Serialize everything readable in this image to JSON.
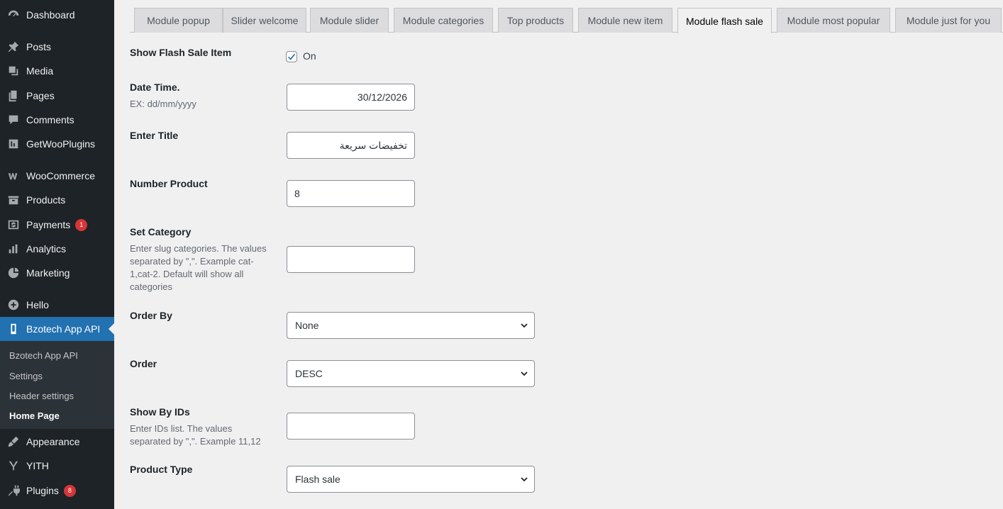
{
  "sidebar": {
    "items": [
      {
        "label": "Dashboard",
        "icon": "dashboard-icon"
      },
      {
        "label": "Posts",
        "icon": "pin-icon"
      },
      {
        "label": "Media",
        "icon": "media-icon"
      },
      {
        "label": "Pages",
        "icon": "pages-icon"
      },
      {
        "label": "Comments",
        "icon": "comment-icon"
      },
      {
        "label": "GetWooPlugins",
        "icon": "plugin-gear-icon"
      },
      {
        "label": "WooCommerce",
        "icon": "woo-icon"
      },
      {
        "label": "Products",
        "icon": "archive-icon"
      },
      {
        "label": "Payments",
        "icon": "dollar-icon",
        "badge": "1"
      },
      {
        "label": "Analytics",
        "icon": "bar-chart-icon"
      },
      {
        "label": "Marketing",
        "icon": "megaphone-icon"
      },
      {
        "label": "Hello",
        "icon": "plus-circle-icon"
      },
      {
        "label": "Bzotech App API",
        "icon": "phone-icon"
      },
      {
        "label": "Appearance",
        "icon": "brush-icon"
      },
      {
        "label": "YITH",
        "icon": "yith-icon"
      },
      {
        "label": "Plugins",
        "icon": "plug-icon",
        "badge": "8"
      }
    ],
    "submenu": [
      "Bzotech App API",
      "Settings",
      "Header settings",
      "Home Page"
    ],
    "accent": "#2271b1"
  },
  "tabs": [
    "Module popup",
    "Slider welcome",
    "Module slider",
    "Module categories",
    "Top products",
    "Module new item",
    "Module flash sale",
    "Module most popular",
    "Module just for you"
  ],
  "form": {
    "show_flash": {
      "label": "Show Flash Sale Item",
      "checked": true,
      "option": "On"
    },
    "date": {
      "label": "Date Time.",
      "desc": "EX: dd/mm/yyyy",
      "value": "30/12/2026"
    },
    "title": {
      "label": "Enter Title",
      "value": "تخفيضات سريعة"
    },
    "number": {
      "label": "Number Product",
      "value": "8"
    },
    "category": {
      "label": "Set Category",
      "desc": "Enter slug categories. The values separated by \",\". Example cat-1,cat-2. Default will show all categories",
      "value": ""
    },
    "order_by": {
      "label": "Order By",
      "value": "None"
    },
    "order": {
      "label": "Order",
      "value": "DESC"
    },
    "ids": {
      "label": "Show By IDs",
      "desc": "Enter IDs list. The values separated by \",\". Example 11,12",
      "value": ""
    },
    "product_type": {
      "label": "Product Type",
      "value": "Flash sale"
    }
  }
}
